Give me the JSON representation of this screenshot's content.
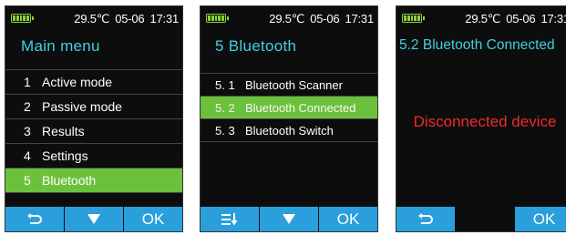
{
  "colors": {
    "accent_title": "#3fd0e0",
    "selected_row": "#6cc13c",
    "softkey": "#2a9fdc",
    "warning_text": "#ee2a2a",
    "battery": "#8bd33a",
    "background": "#0d0d0d"
  },
  "status": {
    "temperature": "29.5℃",
    "date": "05-06",
    "time": "17:31",
    "battery_icon": "battery-icon"
  },
  "screens": [
    {
      "title": "Main  menu",
      "items": [
        {
          "num": "1",
          "label": "Active mode",
          "selected": false
        },
        {
          "num": "2",
          "label": "Passive mode",
          "selected": false
        },
        {
          "num": "3",
          "label": "Results",
          "selected": false
        },
        {
          "num": "4",
          "label": "Settings",
          "selected": false
        },
        {
          "num": "5",
          "label": "Bluetooth",
          "selected": true
        }
      ],
      "softkeys": [
        {
          "icon": "back-icon"
        },
        {
          "icon": "down-arrow-icon"
        },
        {
          "label": "OK"
        }
      ]
    },
    {
      "title": "5 Bluetooth",
      "items": [
        {
          "num": "5. 1",
          "label": "Bluetooth Scanner",
          "selected": false
        },
        {
          "num": "5. 2",
          "label": "Bluetooth Connected",
          "selected": true
        },
        {
          "num": "5. 3",
          "label": "Bluetooth Switch",
          "selected": false
        }
      ],
      "softkeys": [
        {
          "icon": "list-sort-icon"
        },
        {
          "icon": "down-arrow-icon"
        },
        {
          "label": "OK"
        }
      ]
    },
    {
      "title": "5.2 Bluetooth Connected",
      "message": "Disconnected device",
      "softkeys": [
        {
          "icon": "back-icon"
        },
        {
          "label": ""
        },
        {
          "label": "OK"
        }
      ]
    }
  ]
}
